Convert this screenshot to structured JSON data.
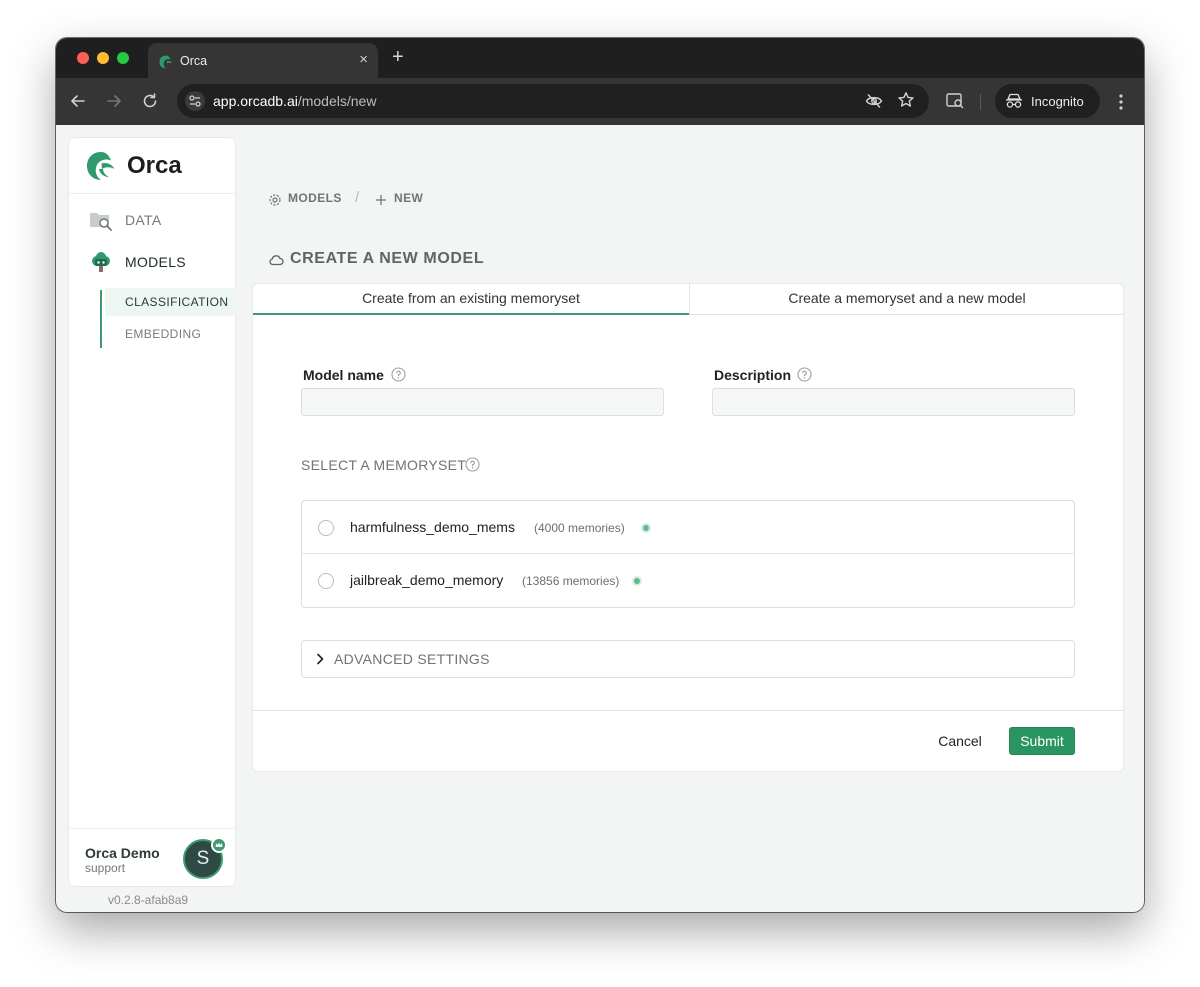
{
  "browser": {
    "tab_title": "Orca",
    "url_host": "app.orcadb.ai",
    "url_path": "/models/new",
    "incognito_label": "Incognito",
    "close_glyph": "×",
    "new_tab_glyph": "+"
  },
  "sidebar": {
    "logo": "Orca",
    "nav": [
      {
        "label": "DATA",
        "icon": "folder-search-icon"
      },
      {
        "label": "MODELS",
        "icon": "tree-robot-icon"
      }
    ],
    "subnav": [
      {
        "label": "CLASSIFICATION",
        "active": true
      },
      {
        "label": "EMBEDDING",
        "active": false
      }
    ],
    "user": {
      "name": "Orca Demo",
      "role": "support",
      "initial": "S"
    },
    "version": "v0.2.8-afab8a9"
  },
  "breadcrumb": {
    "items": [
      {
        "label": "MODELS",
        "icon": "gear-icon"
      },
      {
        "label": "NEW",
        "icon": "plus-icon"
      }
    ],
    "separator": "/"
  },
  "page": {
    "title": "CREATE A NEW MODEL",
    "title_icon": "cloud-icon"
  },
  "tabs": [
    {
      "label": "Create from an existing memoryset",
      "active": true
    },
    {
      "label": "Create a memoryset and a new model",
      "active": false
    }
  ],
  "form": {
    "model_name_label": "Model name",
    "model_name_value": "",
    "description_label": "Description",
    "description_value": "",
    "memoryset_section": "SELECT A MEMORYSET",
    "memorysets": [
      {
        "name": "harmfulness_demo_mems",
        "count": "(4000 memories)"
      },
      {
        "name": "jailbreak_demo_memory",
        "count": "(13856 memories)"
      }
    ],
    "advanced_label": "ADVANCED SETTINGS"
  },
  "actions": {
    "cancel": "Cancel",
    "submit": "Submit"
  },
  "colors": {
    "accent": "#3e9a72",
    "submit": "#2a9560",
    "status_ready": "#5cbd8c"
  }
}
